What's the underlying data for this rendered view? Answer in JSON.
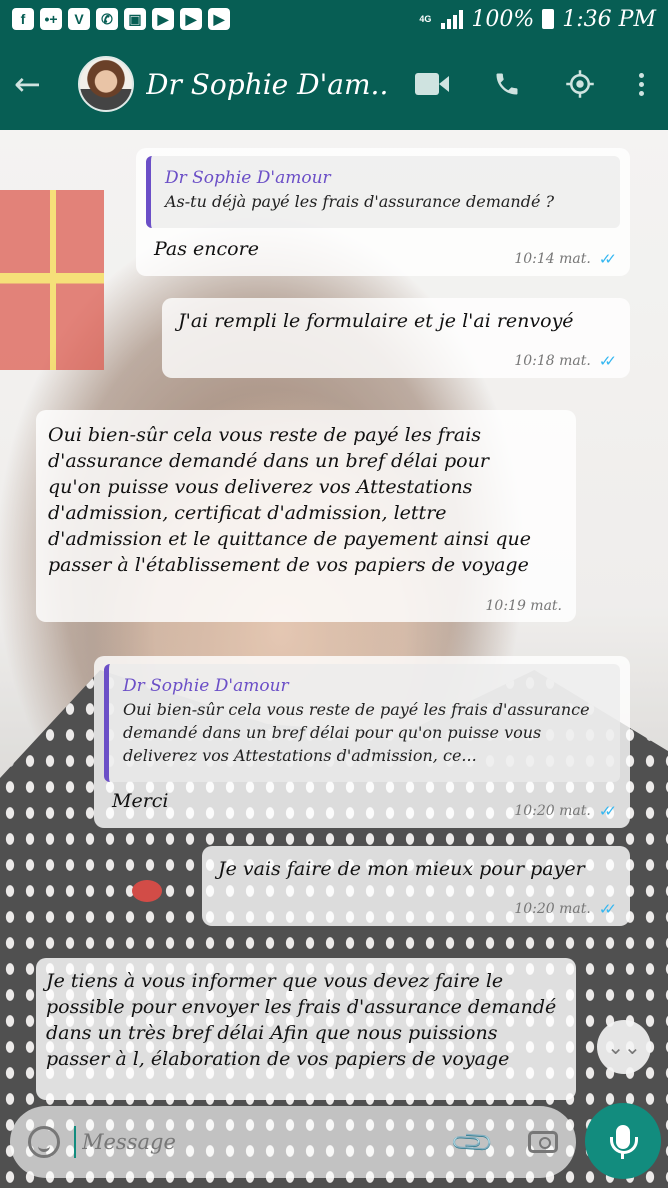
{
  "status_bar": {
    "time": "1:36 PM",
    "battery": "100%",
    "network": "4G",
    "notification_icons": [
      "f",
      "•+",
      "V",
      "✆",
      "▣",
      "▶",
      "▶",
      "▶"
    ]
  },
  "header": {
    "contact_name": "Dr Sophie D'am..."
  },
  "messages": [
    {
      "quote": {
        "author": "Dr Sophie D'amour",
        "text": "As-tu déjà payé les frais d'assurance demandé ?"
      },
      "text": "Pas encore",
      "time": "10:14 mat.",
      "ticks": "✓✓"
    },
    {
      "text": "J'ai rempli le formulaire et je l'ai renvoyé",
      "time": "10:18 mat.",
      "ticks": "✓✓"
    },
    {
      "text": "Oui bien-sûr cela vous reste de payé les frais d'assurance demandé dans un bref délai pour qu'on puisse vous deliverez vos Attestations d'admission, certificat d'admission, lettre d'admission et le quittance de payement ainsi que passer à l'établissement de vos papiers de voyage",
      "time": "10:19 mat."
    },
    {
      "quote": {
        "author": "Dr Sophie D'amour",
        "text": "Oui bien-sûr cela vous reste de payé les frais d'assurance demandé dans un bref délai pour qu'on puisse vous deliverez vos Attestations d'admission, ce..."
      },
      "text": "Merci",
      "time": "10:20 mat.",
      "ticks": "✓✓"
    },
    {
      "text": "Je vais faire de mon mieux pour payer",
      "time": "10:20 mat.",
      "ticks": "✓✓"
    },
    {
      "text": "Je tiens à vous informer que vous devez faire le possible pour envoyer les frais d'assurance demandé dans un très bref délai Afin que nous puissions passer à l, élaboration de vos papiers de voyage"
    }
  ],
  "input": {
    "placeholder": "Message"
  },
  "colors": {
    "brand": "#075e54",
    "accent": "#128c7e",
    "read_ticks": "#34b7f1",
    "quote_bar": "#6b4fc7"
  },
  "icons": {
    "back": "←",
    "scroll_down": "⌄⌄"
  }
}
